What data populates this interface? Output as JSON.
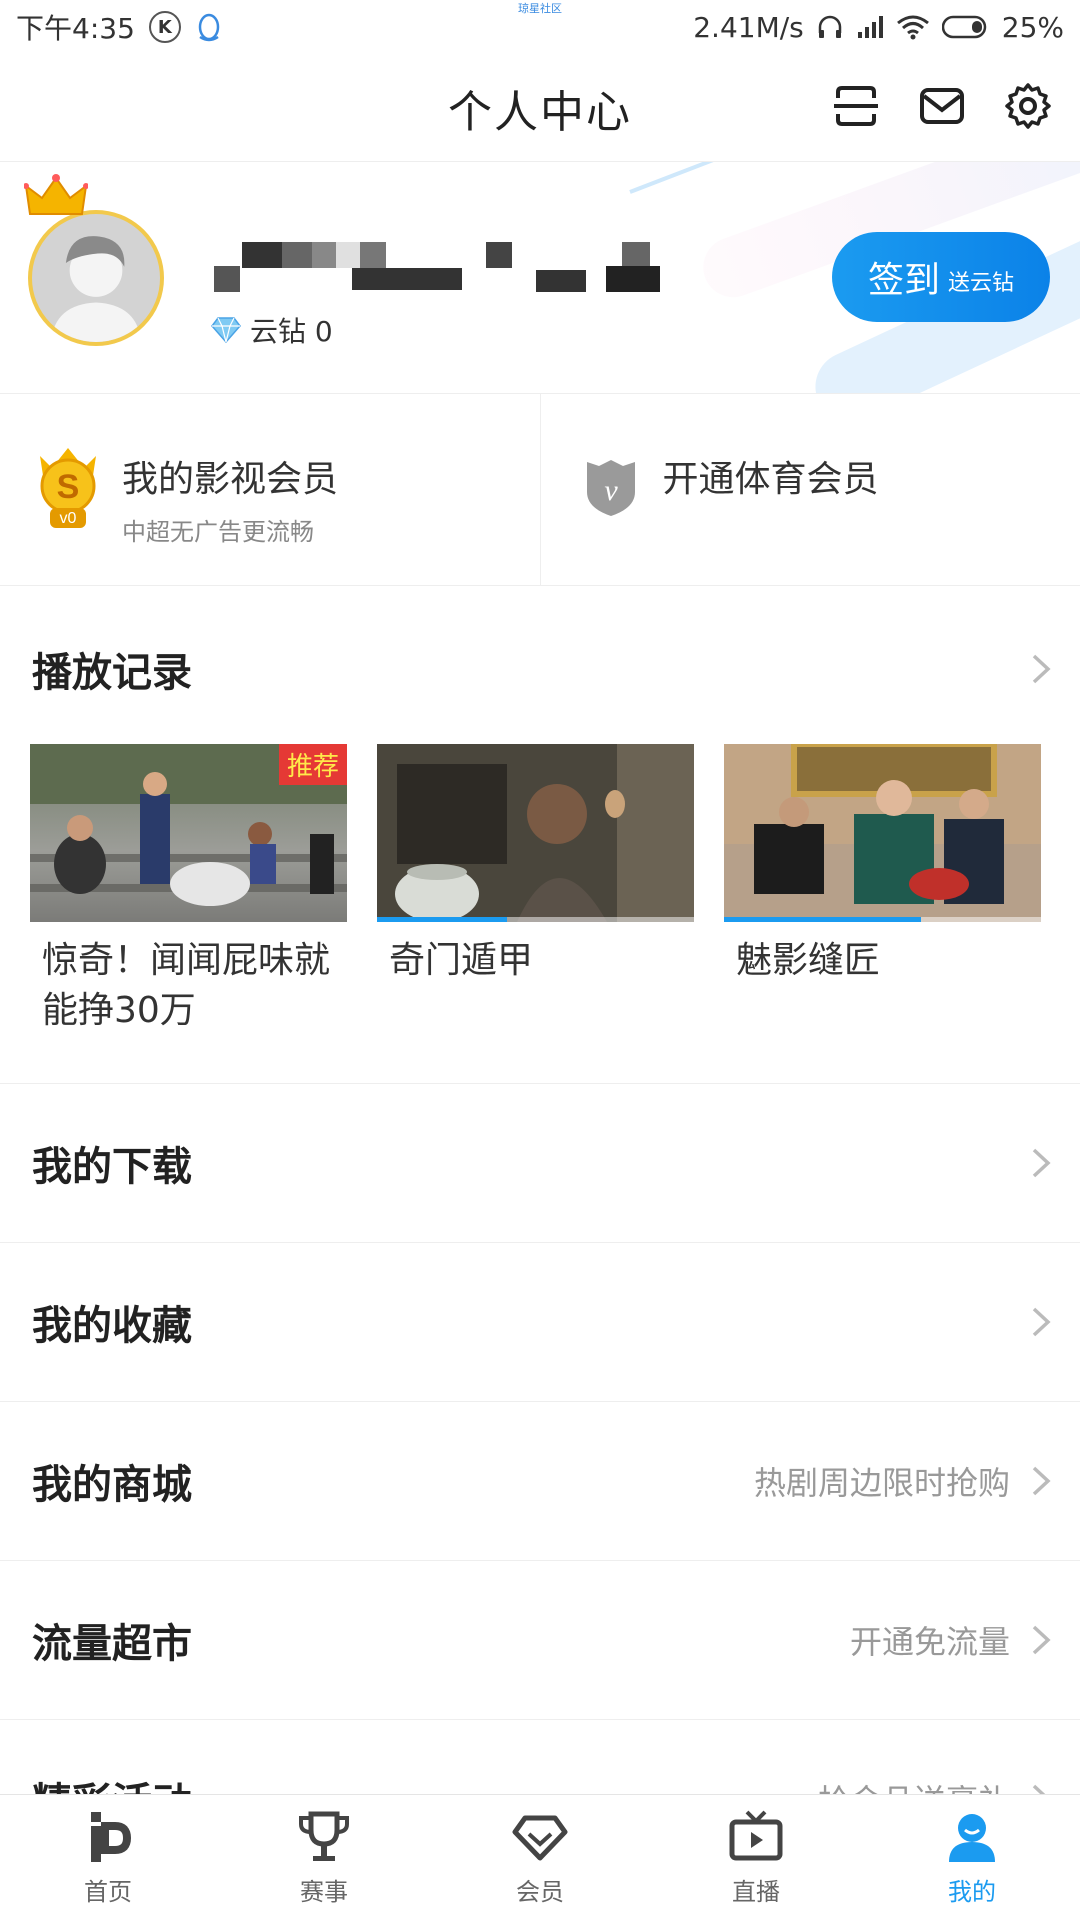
{
  "status_bar": {
    "time": "下午4:35",
    "k_icon_letter": "K",
    "center_label": "琼星社区",
    "net_speed": "2.41M/s",
    "battery": "25%"
  },
  "header": {
    "title": "个人中心"
  },
  "profile": {
    "diamond_label": "云钻 0",
    "signin_label": "签到",
    "signin_sub": "送云钻"
  },
  "membership": {
    "video": {
      "title": "我的影视会员",
      "subtitle": "中超无广告更流畅",
      "level": "v0"
    },
    "sports": {
      "title": "开通体育会员"
    }
  },
  "history": {
    "title": "播放记录",
    "items": [
      {
        "title": "惊奇！闻闻屁味就能挣30万",
        "badge": "推荐",
        "progress": 0
      },
      {
        "title": "奇门遁甲",
        "badge": "",
        "progress": 0.41
      },
      {
        "title": "魅影缝匠",
        "badge": "",
        "progress": 0.62
      }
    ]
  },
  "rows": [
    {
      "title": "我的下载",
      "extra": ""
    },
    {
      "title": "我的收藏",
      "extra": ""
    },
    {
      "title": "我的商城",
      "extra": "热剧周边限时抢购"
    },
    {
      "title": "流量超市",
      "extra": "开通免流量"
    },
    {
      "title": "精彩活动",
      "extra": "拾金品送豪礼"
    }
  ],
  "tabs": [
    {
      "label": "首页",
      "icon": "pp-logo-icon"
    },
    {
      "label": "赛事",
      "icon": "trophy-icon"
    },
    {
      "label": "会员",
      "icon": "diamond-icon"
    },
    {
      "label": "直播",
      "icon": "tv-play-icon"
    },
    {
      "label": "我的",
      "icon": "user-icon"
    }
  ],
  "colors": {
    "accent": "#1b9bf0",
    "badge_red": "#e53935",
    "badge_text": "#ffe94a"
  }
}
